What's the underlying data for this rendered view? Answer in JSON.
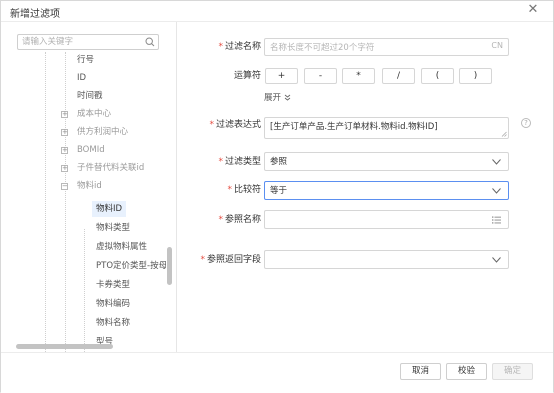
{
  "dialog": {
    "title": "新增过滤项"
  },
  "search": {
    "placeholder": "请输入关键字"
  },
  "tree": {
    "items": [
      {
        "label": "行号"
      },
      {
        "label": "ID"
      },
      {
        "label": "时间戳"
      },
      {
        "label": "成本中心"
      },
      {
        "label": "供方利润中心"
      },
      {
        "label": "BOMId"
      },
      {
        "label": "子件替代料关联id"
      },
      {
        "label": "物料id"
      },
      {
        "label": "物料ID"
      },
      {
        "label": "物料类型"
      },
      {
        "label": "虚拟物料属性"
      },
      {
        "label": "PTO定价类型-按母件"
      },
      {
        "label": "卡券类型"
      },
      {
        "label": "物料编码"
      },
      {
        "label": "物料名称"
      },
      {
        "label": "型号"
      }
    ]
  },
  "form": {
    "filter_name": {
      "label": "过滤名称",
      "placeholder": "名称长度不可超过20个字符",
      "suffix": "CN"
    },
    "operators": {
      "label": "运算符",
      "items": [
        "+",
        "-",
        "*",
        "/",
        "(",
        ")"
      ]
    },
    "expand_label": "展开",
    "expression": {
      "label": "过滤表达式",
      "value": "[生产订单产品.生产订单材料.物料id.物料ID]"
    },
    "filter_type": {
      "label": "过滤类型",
      "value": "参照"
    },
    "comparator": {
      "label": "比较符",
      "value": "等于"
    },
    "ref_name": {
      "label": "参照名称",
      "value": ""
    },
    "ref_return": {
      "label": "参照返回字段",
      "value": ""
    }
  },
  "footer": {
    "cancel": "取消",
    "validate": "校验",
    "confirm": "确定"
  },
  "colors": {
    "required": "#e54d42",
    "focus_border": "#5b8ff0",
    "selected_bg": "#e8f1fd"
  }
}
